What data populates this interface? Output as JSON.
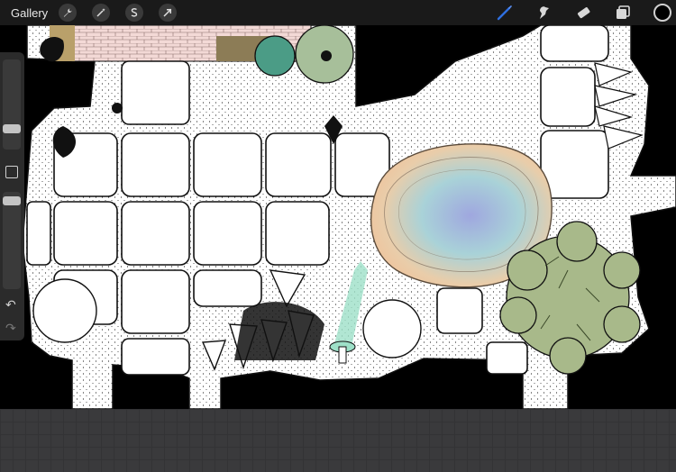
{
  "toolbar": {
    "gallery_label": "Gallery",
    "left_icons": [
      "wrench-icon",
      "magic-wand-icon",
      "selection-icon",
      "transform-arrow-icon"
    ],
    "right_tools": [
      "brush-icon",
      "smudge-icon",
      "eraser-icon",
      "layers-icon"
    ],
    "active_tool_color": "#2f6fe0",
    "current_color": "#000000"
  },
  "sidebar": {
    "brush_size_level": 0.42,
    "opacity_level": 0.95
  },
  "colors": {
    "toolbar_bg": "#1a1a1a",
    "canvas_bg": "#000000",
    "paper": "#ffffff",
    "pond_orange": "#f1c9a3",
    "pond_blue": "#9fa7df",
    "tree_green": "#a8b98a",
    "teal_bush": "#4b9c86",
    "sage_bush": "#a7bf9a",
    "mushroom_teal": "#9ee0c8"
  }
}
